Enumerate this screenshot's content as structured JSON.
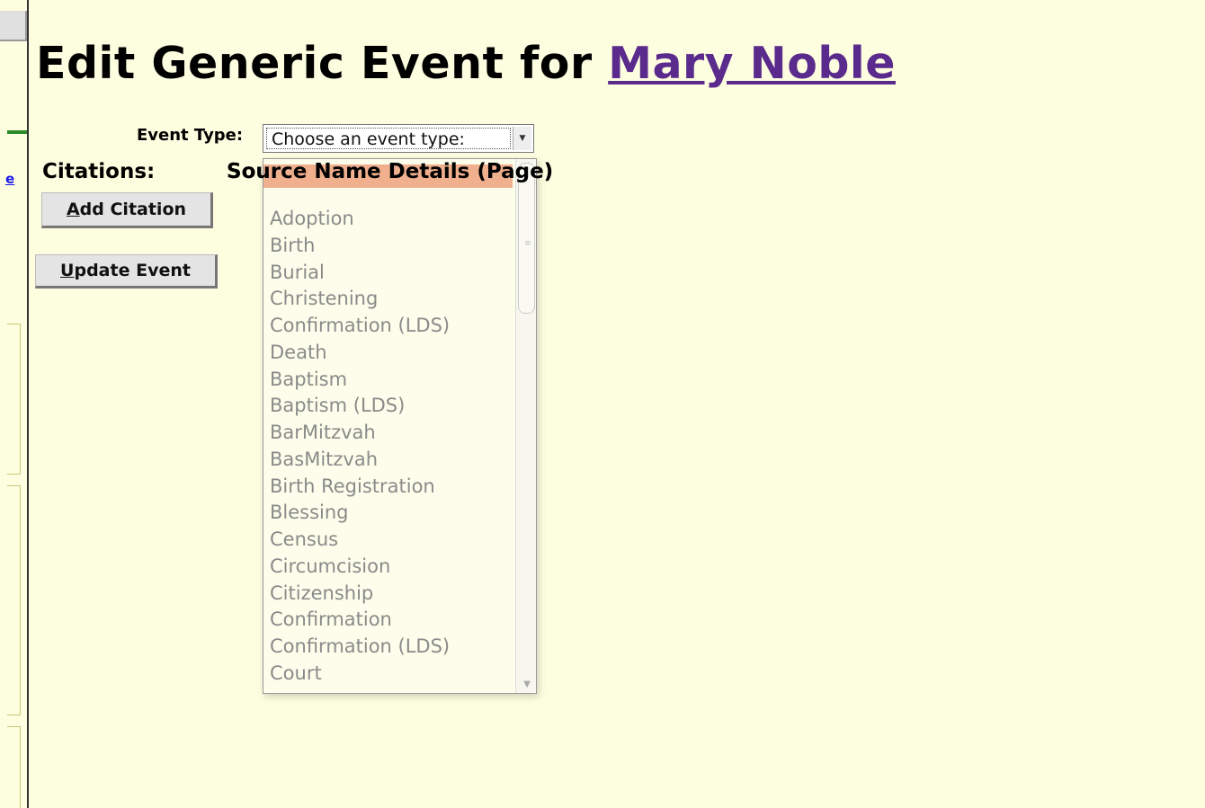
{
  "header": {
    "title_prefix": "Edit Generic Event for",
    "person_name": "Mary Noble"
  },
  "form": {
    "event_type_label": "Event Type:",
    "event_type_selected": "Choose an event type:",
    "citations_label": "Citations:",
    "source_column_header": "Source Name Details (Page)",
    "add_citation_accel": "A",
    "add_citation_rest": "dd Citation",
    "update_event_accel": "U",
    "update_event_rest": "pdate Event"
  },
  "dropdown": {
    "options": [
      "Adoption",
      "Birth",
      "Burial",
      "Christening",
      "Confirmation (LDS)",
      "Death",
      "Baptism",
      "Baptism (LDS)",
      "BarMitzvah",
      "BasMitzvah",
      "Birth Registration",
      "Blessing",
      "Census",
      "Circumcision",
      "Citizenship",
      "Confirmation",
      "Confirmation (LDS)",
      "Court"
    ]
  },
  "colors": {
    "background": "#fdfde0",
    "link": "#5a2a8c",
    "highlight": "#f0b08e"
  }
}
